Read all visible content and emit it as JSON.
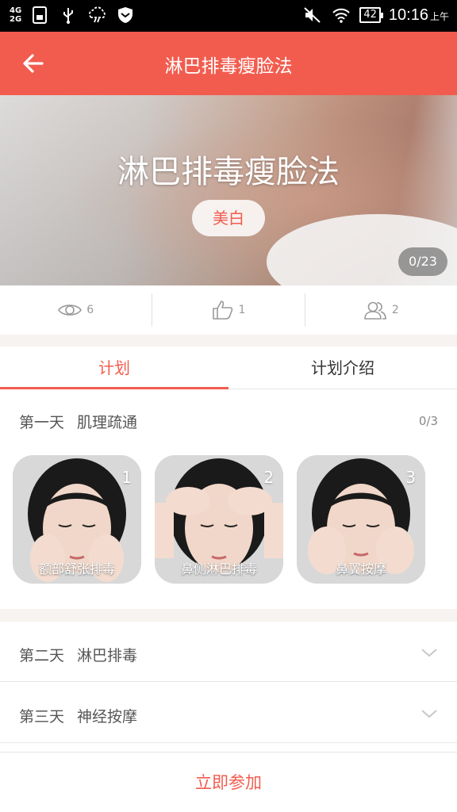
{
  "status_bar": {
    "network_top": "4G",
    "network_bottom": "2G",
    "battery": "42",
    "time": "10:16",
    "time_suffix": "上午"
  },
  "app_bar": {
    "title": "淋巴排毒瘦脸法"
  },
  "hero": {
    "title": "淋巴排毒瘦脸法",
    "tag": "美白",
    "counter": "0/23"
  },
  "stats": {
    "views": "6",
    "likes": "1",
    "participants": "2"
  },
  "tabs": [
    {
      "label": "计划"
    },
    {
      "label": "计划介绍"
    }
  ],
  "plan": {
    "day1": {
      "day": "第一天",
      "name": "肌理疏通",
      "progress": "0/3",
      "steps": [
        {
          "num": "1",
          "label": "额部舒张排毒"
        },
        {
          "num": "2",
          "label": "鼻侧淋巴排毒"
        },
        {
          "num": "3",
          "label": "鼻翼按摩"
        }
      ]
    },
    "day2": {
      "day": "第二天",
      "name": "淋巴排毒"
    },
    "day3": {
      "day": "第三天",
      "name": "神经按摩"
    }
  },
  "footer": {
    "join_label": "立即参加"
  },
  "colors": {
    "accent": "#f25c4e",
    "background_gap": "#f7f3f0"
  }
}
